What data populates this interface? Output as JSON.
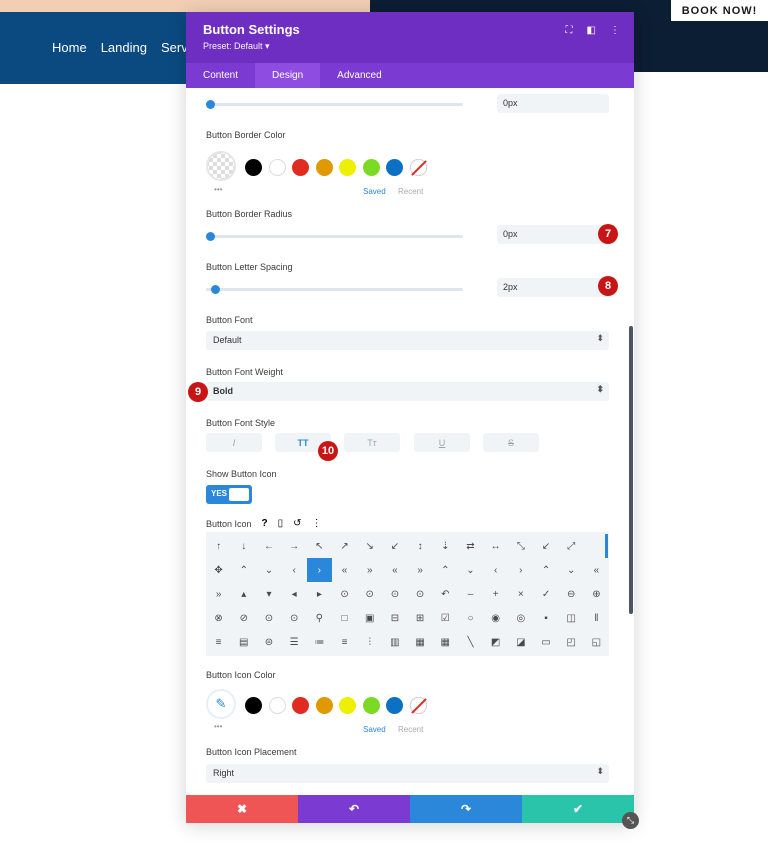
{
  "site": {
    "nav": [
      "Home",
      "Landing",
      "Servi"
    ],
    "book_button": "BOOK NOW!"
  },
  "modal": {
    "title": "Button Settings",
    "preset": "Preset: Default ▾",
    "tabs": [
      "Content",
      "Design",
      "Advanced"
    ],
    "active_tab": "Design"
  },
  "fields": {
    "top_value": "0px",
    "border_color_label": "Button Border Color",
    "saved": "Saved",
    "recent": "Recent",
    "border_radius_label": "Button Border Radius",
    "border_radius_value": "0px",
    "letter_spacing_label": "Button Letter Spacing",
    "letter_spacing_value": "2px",
    "font_label": "Button Font",
    "font_value": "Default",
    "weight_label": "Button Font Weight",
    "weight_value": "Bold",
    "style_label": "Button Font Style",
    "style_buttons": [
      "I",
      "TT",
      "Tт",
      "U",
      "S"
    ],
    "show_icon_label": "Show Button Icon",
    "toggle_yes": "YES",
    "icon_label": "Button Icon",
    "icon_color_label": "Button Icon Color",
    "icon_placement_label": "Button Icon Placement",
    "icon_placement_value": "Right"
  },
  "badges": [
    "7",
    "8",
    "9",
    "10"
  ],
  "swatch_colors": [
    "#000000",
    "#ffffff",
    "#e02b20",
    "#e09900",
    "#edf000",
    "#7cda24",
    "#0c71c3",
    "#8300e9"
  ],
  "icon_glyphs": [
    "↑",
    "↓",
    "←",
    "→",
    "↖",
    "↗",
    "↘",
    "↙",
    "↕",
    "⇣",
    "⇄",
    "↔",
    "⤡",
    "↙",
    "⤢",
    "",
    "✥",
    "⌃",
    "⌄",
    "‹",
    "›",
    "«",
    "»",
    "«",
    "»",
    "⌃",
    "⌄",
    "‹",
    "›",
    "⌃",
    "⌄",
    "«",
    "»",
    "▴",
    "▾",
    "◂",
    "▸",
    "⊙",
    "⊙",
    "⊙",
    "⊙",
    "↶",
    "–",
    "+",
    "×",
    "✓",
    "⊖",
    "⊕",
    "⊗",
    "⊘",
    "⊙",
    "⊙",
    "⚲",
    "□",
    "▣",
    "⊟",
    "⊞",
    "☑",
    "○",
    "◉",
    "◎",
    "▪",
    "◫",
    "‖",
    "≡",
    "▤",
    "⊜",
    "☰",
    "≔",
    "≡",
    "⫶",
    "▥",
    "▦",
    "▦",
    "╲",
    "◩",
    "◪",
    "▭",
    "◰",
    "◱"
  ],
  "footer": {
    "cancel": "✖",
    "undo": "↶",
    "redo": "↷",
    "save": "✔",
    "colors": [
      "#ef5555",
      "#7b3ad1",
      "#2b87da",
      "#29c4a9"
    ]
  }
}
